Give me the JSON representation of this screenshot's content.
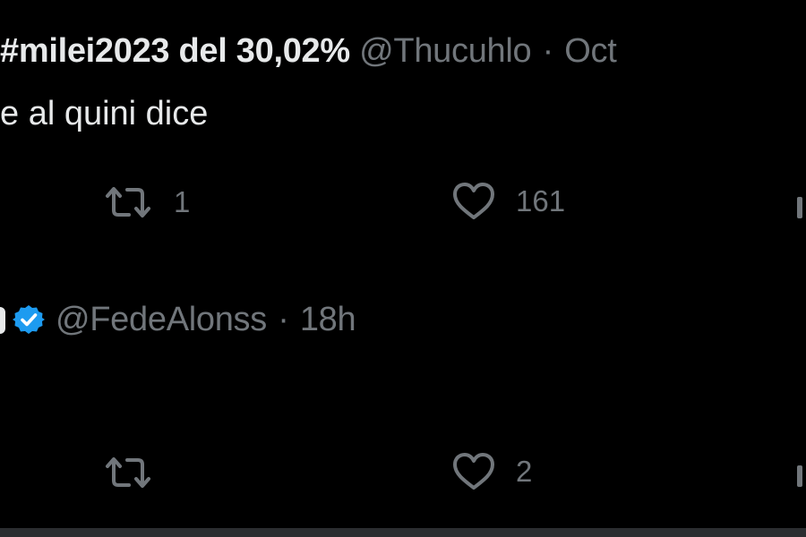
{
  "tweets": [
    {
      "display_name": "#milei2023 del 30,02%",
      "handle": "@Thucuhlo",
      "separator": "·",
      "timestamp": "Oct",
      "text": "e al quini dice",
      "retweet_count": "1",
      "like_count": "161"
    },
    {
      "display_name": "",
      "verified": true,
      "handle": "@FedeAlonss",
      "separator": "·",
      "timestamp": "18h",
      "text": "",
      "retweet_count": "",
      "like_count": "2"
    }
  ],
  "icons": {
    "retweet": "retweet-icon",
    "like": "heart-icon",
    "verified": "verified-badge-icon",
    "share": "share-icon"
  },
  "colors": {
    "background": "#000000",
    "primary_text": "#e7e9ea",
    "secondary_text": "#71767b",
    "verified_blue": "#1d9bf0"
  }
}
